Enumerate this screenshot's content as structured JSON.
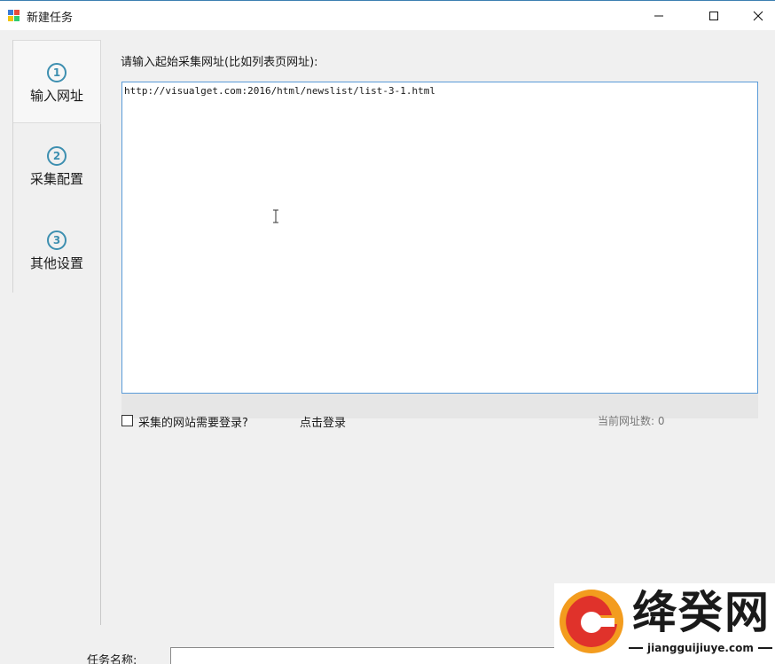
{
  "window": {
    "title": "新建任务"
  },
  "steps": [
    {
      "number": "1",
      "label": "输入网址",
      "active": true
    },
    {
      "number": "2",
      "label": "采集配置",
      "active": false
    },
    {
      "number": "3",
      "label": "其他设置",
      "active": false
    }
  ],
  "main": {
    "prompt": "请输入起始采集网址(比如列表页网址):",
    "url_text": "http://visualget.com:2016/html/newslist/list-3-1.html",
    "login_required_label": "采集的网站需要登录?",
    "login_required_checked": false,
    "login_link": "点击登录",
    "url_count": "当前网址数: 0"
  },
  "footer": {
    "task_name_label": "任务名称:",
    "task_name_value": ""
  },
  "watermark": {
    "title": "绛癸网",
    "url": "jiangguijiuye.com"
  },
  "colors": {
    "accent": "#3d8fb0",
    "input_border": "#5a9bd8",
    "logo_orange": "#f39c1e",
    "logo_red": "#e0322b"
  }
}
